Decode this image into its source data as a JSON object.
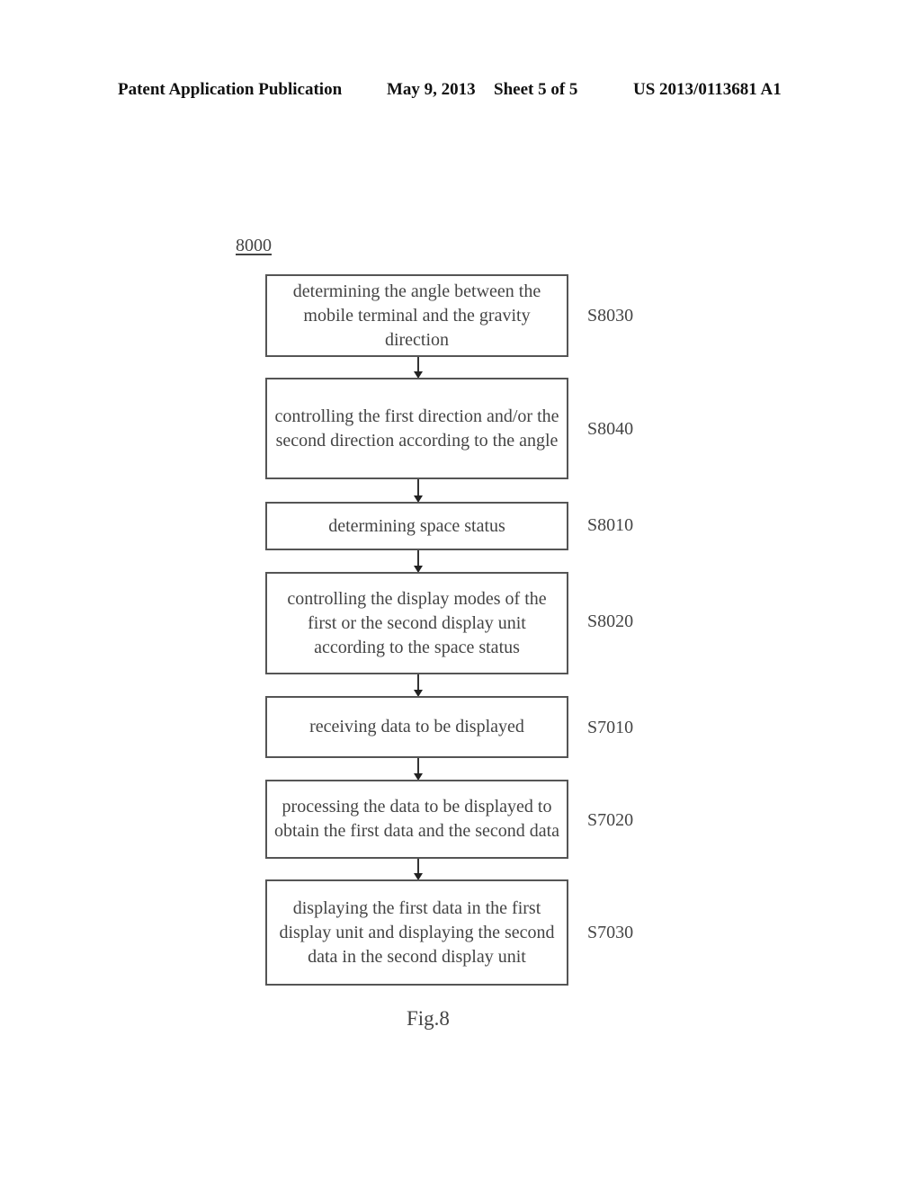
{
  "header": {
    "publication": "Patent Application Publication",
    "date": "May 9, 2013",
    "sheet": "Sheet 5 of 5",
    "number": "US 2013/0113681 A1"
  },
  "diagram": {
    "reference": "8000",
    "steps": [
      {
        "text": "determining the angle between the mobile terminal and the gravity direction",
        "label": "S8030"
      },
      {
        "text": "controlling the first direction and/or the second direction according to the angle",
        "label": "S8040"
      },
      {
        "text": "determining space status",
        "label": "S8010"
      },
      {
        "text": "controlling the display modes of the first or the second display unit according to the space status",
        "label": "S8020"
      },
      {
        "text": "receiving data to be displayed",
        "label": "S7010"
      },
      {
        "text": "processing the data to be displayed to obtain the first data and the second data",
        "label": "S7020"
      },
      {
        "text": "displaying the first data in the first display unit and displaying the second data in the second display unit",
        "label": "S7030"
      }
    ],
    "caption": "Fig.8"
  }
}
